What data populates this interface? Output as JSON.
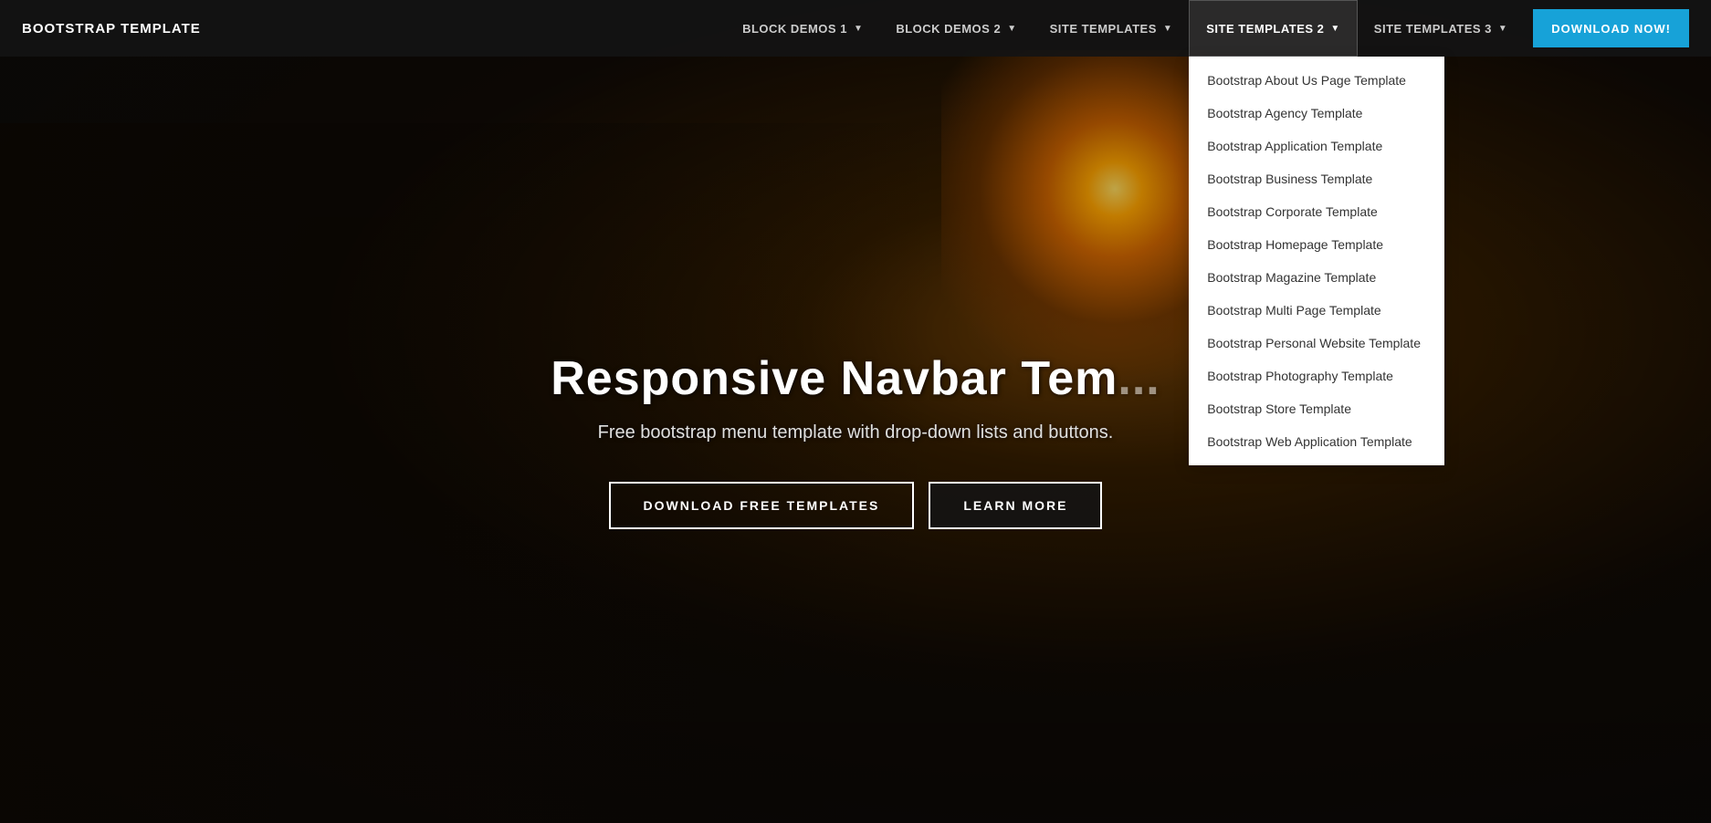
{
  "brand": {
    "label": "BOOTSTRAP TEMPLATE"
  },
  "navbar": {
    "items": [
      {
        "id": "block-demos-1",
        "label": "BLOCK DEMOS 1",
        "has_dropdown": true
      },
      {
        "id": "block-demos-2",
        "label": "BLOCK DEMOS 2",
        "has_dropdown": true
      },
      {
        "id": "site-templates",
        "label": "SITE TEMPLATES",
        "has_dropdown": true
      },
      {
        "id": "site-templates-2",
        "label": "SITE TEMPLATES 2",
        "has_dropdown": true,
        "active": true
      },
      {
        "id": "site-templates-3",
        "label": "SITE TEMPLATES 3",
        "has_dropdown": true
      }
    ],
    "cta_label": "DOWNLOAD NOW!"
  },
  "dropdown": {
    "items": [
      "Bootstrap About Us Page Template",
      "Bootstrap Agency Template",
      "Bootstrap Application Template",
      "Bootstrap Business Template",
      "Bootstrap Corporate Template",
      "Bootstrap Homepage Template",
      "Bootstrap Magazine Template",
      "Bootstrap Multi Page Template",
      "Bootstrap Personal Website Template",
      "Bootstrap Photography Template",
      "Bootstrap Store Template",
      "Bootstrap Web Application Template"
    ]
  },
  "hero": {
    "title": "Responsive Navbar Tem...",
    "subtitle": "Free bootstrap menu template with drop-down lists and buttons.",
    "btn_primary": "DOWNLOAD FREE TEMPLATES",
    "btn_secondary": "LEARN MORE"
  }
}
